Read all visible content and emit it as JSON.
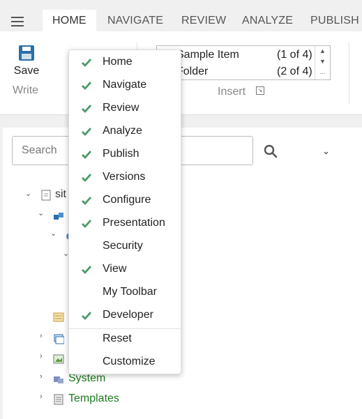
{
  "tabs": [
    {
      "label": "HOME",
      "active": true
    },
    {
      "label": "NAVIGATE",
      "active": false
    },
    {
      "label": "REVIEW",
      "active": false
    },
    {
      "label": "ANALYZE",
      "active": false
    },
    {
      "label": "PUBLISH",
      "active": false
    }
  ],
  "ribbon": {
    "save_label": "Save",
    "write_label": "Write",
    "insert_label": "Insert",
    "insert_rows": [
      {
        "label": "Sample Item",
        "count": "(1 of 4)"
      },
      {
        "label": "Folder",
        "count": "(2 of 4)"
      }
    ],
    "scroll_more": "..."
  },
  "search": {
    "placeholder": "Search"
  },
  "tree": {
    "root_label": "sit",
    "system_label": "System",
    "templates_label": "Templates"
  },
  "menu": {
    "items": [
      {
        "label": "Home",
        "checked": true
      },
      {
        "label": "Navigate",
        "checked": true
      },
      {
        "label": "Review",
        "checked": true
      },
      {
        "label": "Analyze",
        "checked": true
      },
      {
        "label": "Publish",
        "checked": true
      },
      {
        "label": "Versions",
        "checked": true
      },
      {
        "label": "Configure",
        "checked": true
      },
      {
        "label": "Presentation",
        "checked": true
      },
      {
        "label": "Security",
        "checked": false
      },
      {
        "label": "View",
        "checked": true
      },
      {
        "label": "My Toolbar",
        "checked": false
      },
      {
        "label": "Developer",
        "checked": true
      }
    ],
    "actions": [
      {
        "label": "Reset"
      },
      {
        "label": "Customize"
      }
    ]
  },
  "colors": {
    "check": "#4a9a6a",
    "tree_text": "#1d7a1d",
    "accent": "#2b6fa8"
  }
}
